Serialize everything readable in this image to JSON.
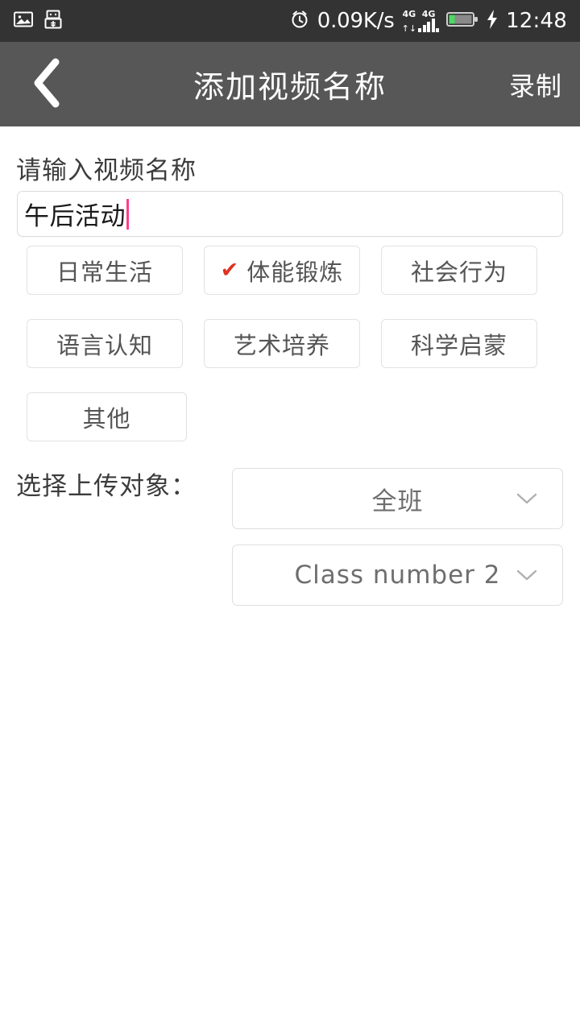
{
  "status_bar": {
    "left_icons": [
      "image-icon",
      "usb-icon"
    ],
    "alarm_icon": "alarm-icon",
    "network_speed": "0.09K/s",
    "signal_labels": [
      "4G",
      "4G"
    ],
    "battery_icon": "battery-icon",
    "charging_icon": "charging-bolt-icon",
    "time": "12:48",
    "background_color": "#333333"
  },
  "appbar": {
    "back_icon": "back-chevron-icon",
    "title": "添加视频名称",
    "action_label": "录制",
    "background_color": "#575757"
  },
  "form": {
    "name_label": "请输入视频名称",
    "name_value": "午后活动",
    "name_placeholder": "请输入视频名称",
    "caret_color": "#ff3d8a"
  },
  "categories": {
    "selected_check_icon": "check-icon",
    "selected_check_color": "#dd3322",
    "rows": [
      [
        {
          "label": "日常生活",
          "selected": false
        },
        {
          "label": "体能锻炼",
          "selected": true
        },
        {
          "label": "社会行为",
          "selected": false
        }
      ],
      [
        {
          "label": "语言认知",
          "selected": false
        },
        {
          "label": "艺术培养",
          "selected": false
        },
        {
          "label": "科学启蒙",
          "selected": false
        }
      ],
      [
        {
          "label": "其他",
          "selected": false
        }
      ]
    ]
  },
  "upload": {
    "label": "选择上传对象：",
    "scope_value": "全班",
    "class_value": "Class number 2",
    "chevron_icon": "chevron-down-icon"
  }
}
